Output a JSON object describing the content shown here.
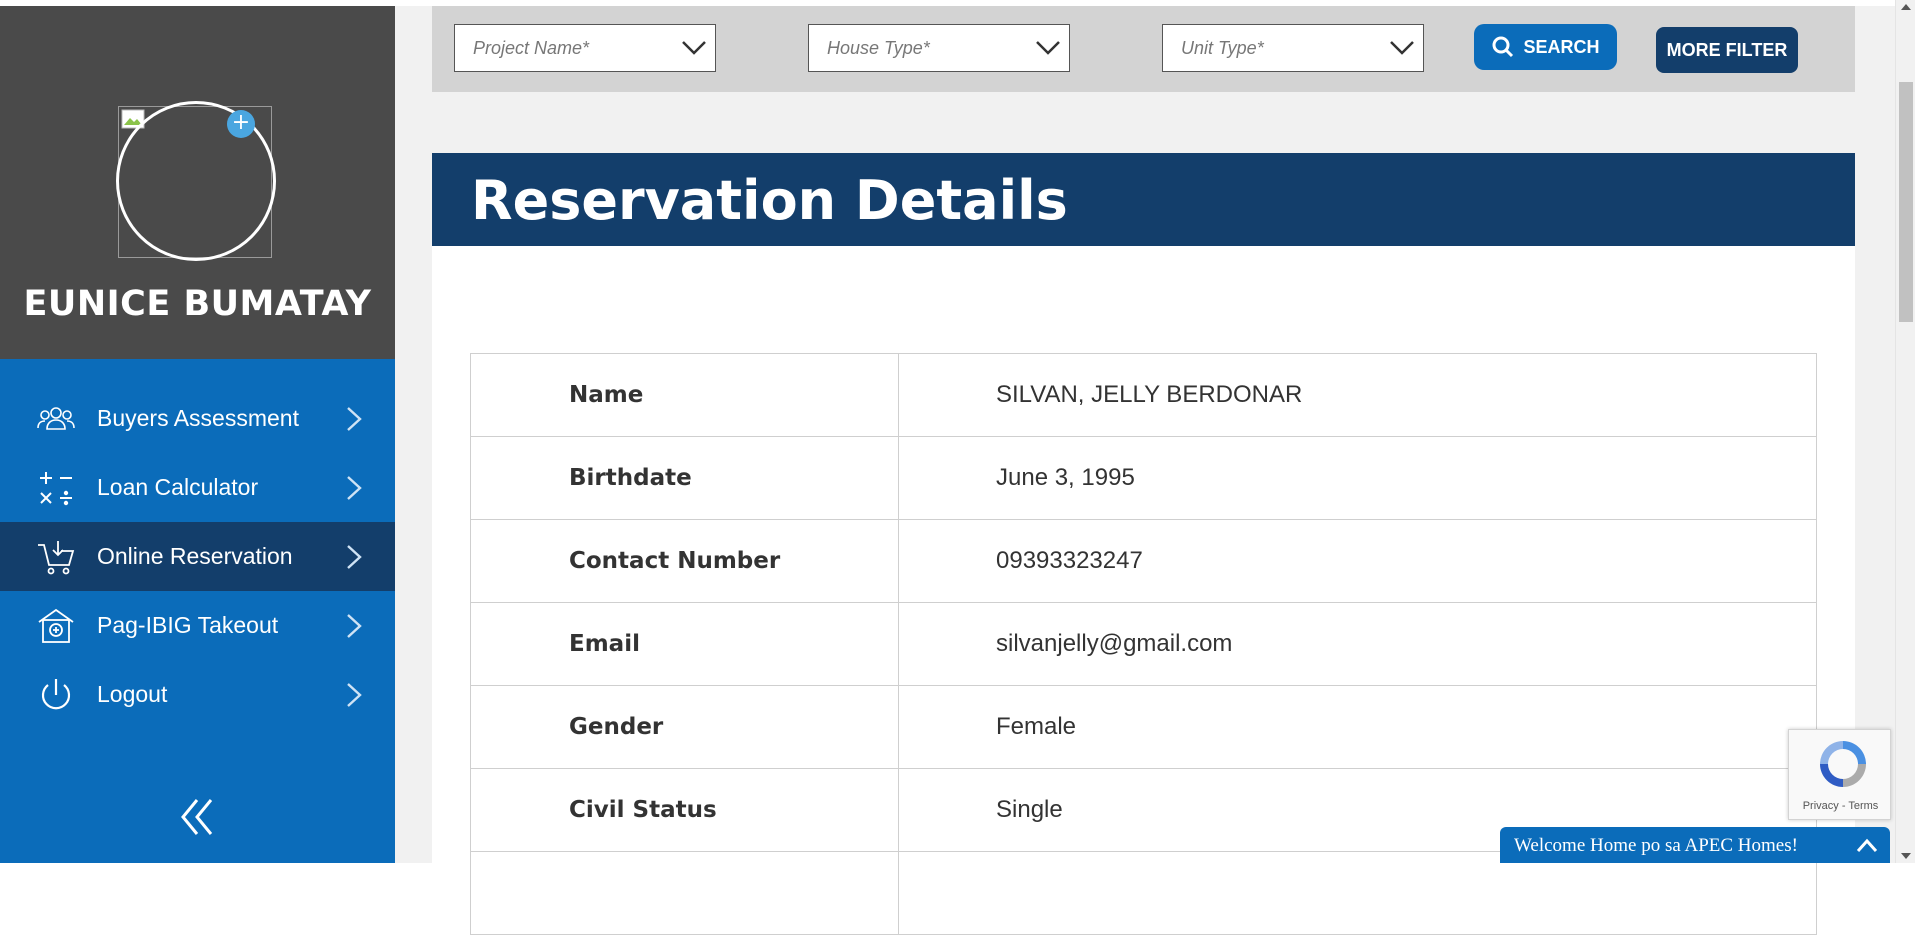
{
  "profile": {
    "name": "EUNICE BUMATAY"
  },
  "nav": {
    "items": [
      {
        "label": "Buyers Assessment",
        "icon": "users-icon"
      },
      {
        "label": "Loan Calculator",
        "icon": "calculator-icon"
      },
      {
        "label": "Online Reservation",
        "icon": "cart-icon",
        "active": true
      },
      {
        "label": "Pag-IBIG Takeout",
        "icon": "house-icon"
      },
      {
        "label": "Logout",
        "icon": "power-icon"
      }
    ]
  },
  "filters": {
    "project_placeholder": "Project Name*",
    "house_placeholder": "House Type*",
    "unit_placeholder": "Unit Type*",
    "search_label": "SEARCH",
    "more_filter_label": "MORE FILTER"
  },
  "card": {
    "title": "Reservation Details"
  },
  "details": [
    {
      "key": "Name",
      "value": "SILVAN, JELLY BERDONAR"
    },
    {
      "key": "Birthdate",
      "value": "June 3, 1995"
    },
    {
      "key": "Contact Number",
      "value": "09393323247"
    },
    {
      "key": "Email",
      "value": "silvanjelly@gmail.com"
    },
    {
      "key": "Gender",
      "value": "Female"
    },
    {
      "key": "Civil Status",
      "value": "Single"
    }
  ],
  "recaptcha": {
    "links": "Privacy - Terms"
  },
  "chat": {
    "text": "Welcome Home po sa APEC Homes!"
  },
  "colors": {
    "primary_blue": "#0b6cba",
    "dark_navy": "#133e6b",
    "profile_bg": "#4a4a4a"
  }
}
